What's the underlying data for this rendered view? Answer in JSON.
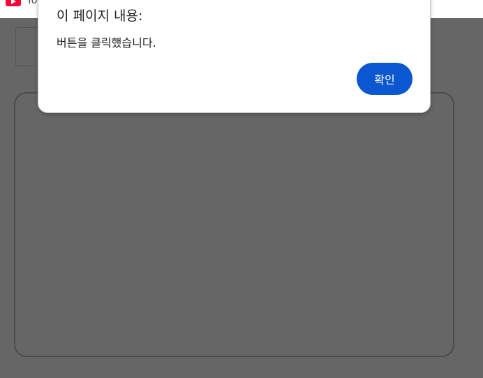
{
  "browser": {
    "tab_title": "Yo",
    "favicon_icon": "youtube-icon",
    "favicon_color": "#ff0033"
  },
  "dialog": {
    "title": "이 페이지 내용:",
    "message": "버튼을 클릭했습니다.",
    "ok_label": "확인",
    "accent": "#0b57d0"
  }
}
